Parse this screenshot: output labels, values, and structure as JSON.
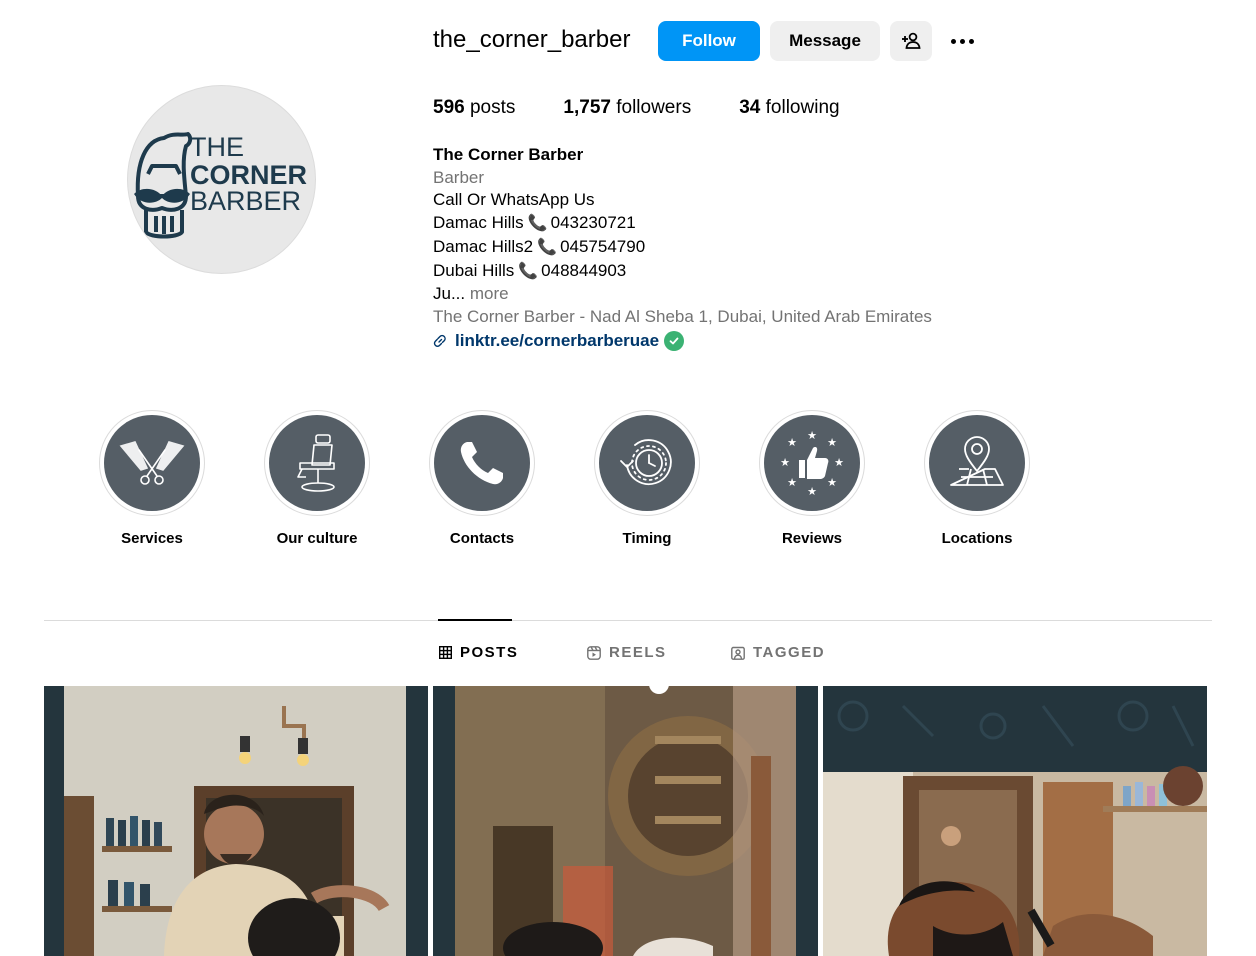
{
  "profile": {
    "username": "the_corner_barber",
    "avatar_logo": {
      "line1": "THE",
      "line2": "CORNER",
      "line3": "BARBER"
    },
    "buttons": {
      "follow": "Follow",
      "message": "Message"
    },
    "stats": {
      "posts_count": "596",
      "posts_label": "posts",
      "followers_count": "1,757",
      "followers_label": "followers",
      "following_count": "34",
      "following_label": "following"
    },
    "bio": {
      "name": "The Corner Barber",
      "category": "Barber",
      "line1": "Call Or WhatsApp Us",
      "loc1": "Damac Hills",
      "phone1": "043230721",
      "loc2": "Damac Hills2",
      "phone2": "045754790",
      "loc3": "Dubai Hills",
      "phone3": "048844903",
      "truncated": "Ju...",
      "more": "more",
      "address": "The Corner Barber - Nad Al Sheba 1, Dubai, United Arab Emirates",
      "link": "linktr.ee/cornerbarberuae"
    }
  },
  "highlights": [
    {
      "label": "Services",
      "icon": "scissors-combs-icon"
    },
    {
      "label": "Our culture",
      "icon": "barber-chair-icon"
    },
    {
      "label": "Contacts",
      "icon": "phone-icon"
    },
    {
      "label": "Timing",
      "icon": "clock-icon"
    },
    {
      "label": "Reviews",
      "icon": "thumbs-up-stars-icon"
    },
    {
      "label": "Locations",
      "icon": "map-pin-icon"
    }
  ],
  "tabs": {
    "posts": "POSTS",
    "reels": "REELS",
    "tagged": "TAGGED",
    "active": "posts"
  },
  "colors": {
    "accent": "#0095f6",
    "highlight_bg": "#555e66",
    "link": "#00376b",
    "logo": "#1e3a4c"
  }
}
